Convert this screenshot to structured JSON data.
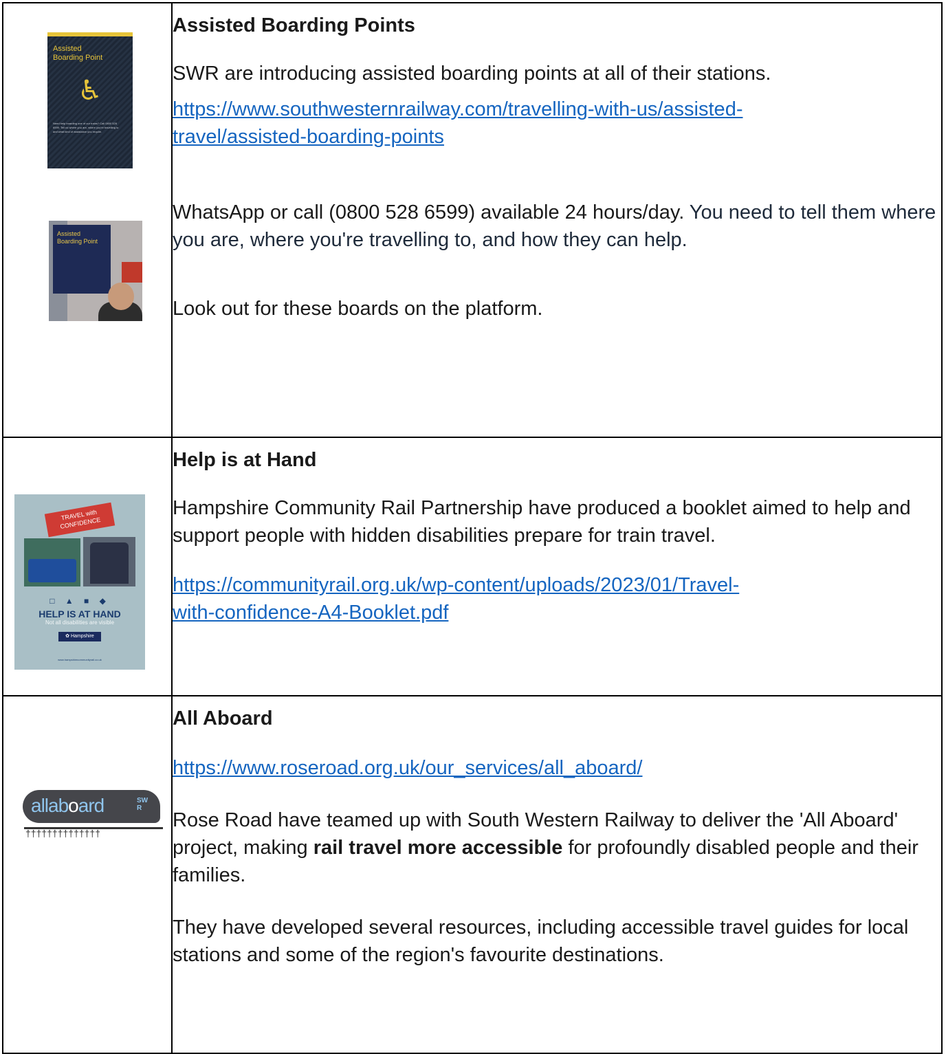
{
  "sections": [
    {
      "title": "Assisted Boarding Points",
      "intro": "SWR are introducing assisted boarding points at all of their stations.",
      "link_line1": "https://www.southwesternrailway.com/travelling-with-us/assisted-",
      "link_line2": "travel/assisted-boarding-points",
      "contact_part1": "WhatsApp or call (0800 528 6599) available 24 hours/day.",
      "contact_part2": " You need to tell them where you are, where you're travelling to, and how they can help.",
      "lookout": "Look out for these boards on the platform.",
      "image1": {
        "line1": "Assisted",
        "line2": "Boarding Point",
        "icon": "wheelchair-icon",
        "small": "Need help boarding one of our trains? Call 0800 528 6599. Tell us where you are, where you're travelling to and what kind of assistance you require."
      },
      "image2": {
        "line1": "Assisted",
        "line2": "Boarding Point"
      }
    },
    {
      "title": "Help is at Hand",
      "body": "Hampshire Community Rail Partnership have produced a booklet aimed to help and support people with hidden disabilities prepare for train travel.",
      "link_line1": "https://communityrail.org.uk/wp-content/uploads/2023/01/Travel-",
      "link_line2": "with-confidence-A4-Booklet.pdf",
      "booklet": {
        "tag": "TRAVEL with CONFIDENCE",
        "icons": "□ ▲ ■ ◆",
        "heading": "HELP IS AT HAND",
        "sub": "Not all disabilities are visible",
        "logo": "✿ Hampshire",
        "url": "www.hampshirecommunityrail.co.uk"
      }
    },
    {
      "title": "All Aboard",
      "link": "https://www.roseroad.org.uk/our_services/all_aboard/",
      "body_part1": "Rose Road have teamed up with South Western Railway to deliver the 'All Aboard' project, making ",
      "body_bold": "rail travel more accessible",
      "body_part2": " for profoundly disabled people and their families.",
      "body2": "They have developed several resources, including accessible travel guides for local stations and some of the region's favourite destinations.",
      "logo": {
        "prefix": "allab",
        "mid": "o",
        "suffix": "ard",
        "badge_top": "SW",
        "badge_bottom": "R",
        "sleepers": "††††††††††††††"
      }
    }
  ],
  "colors": {
    "link": "#1565c0",
    "border": "#000000",
    "text": "#1a1a1a"
  }
}
